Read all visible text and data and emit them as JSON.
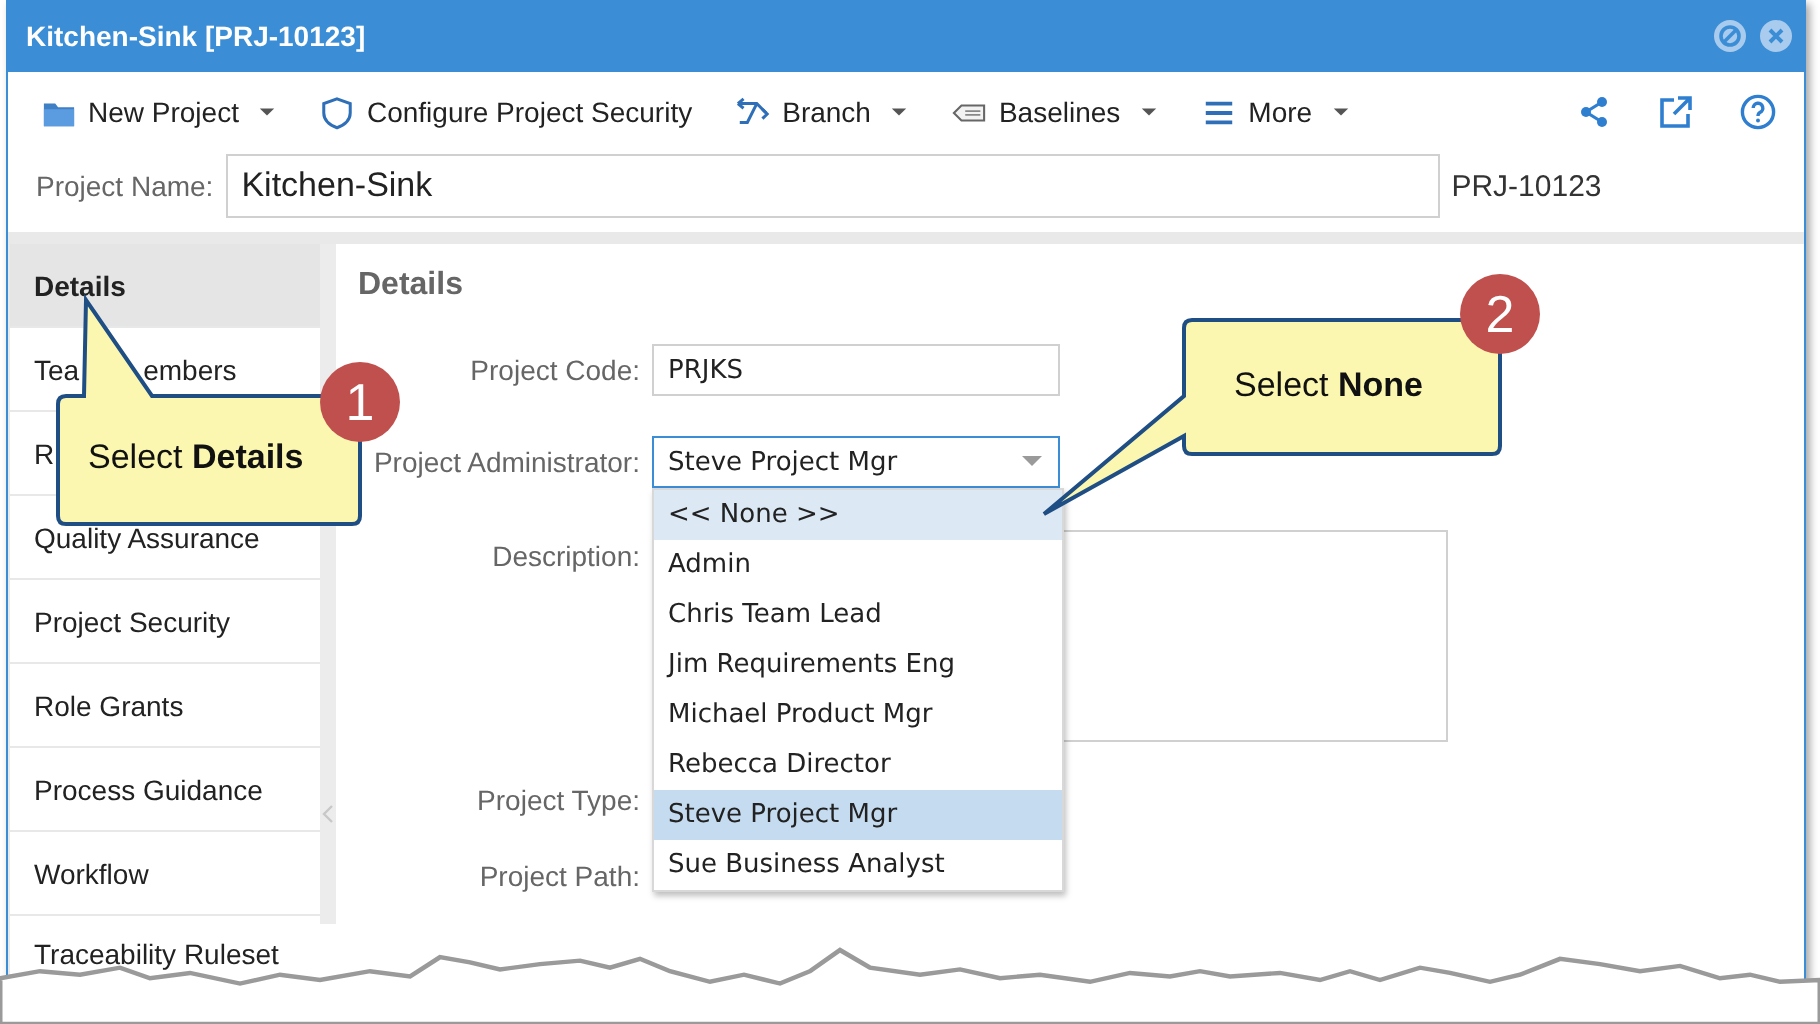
{
  "window": {
    "title": "Kitchen-Sink [PRJ-10123]"
  },
  "toolbar": {
    "items": [
      {
        "label": "New Project",
        "kind": "folder",
        "dropdown": true
      },
      {
        "label": "Configure Project Security",
        "kind": "shield",
        "dropdown": false
      },
      {
        "label": "Branch",
        "kind": "branch",
        "dropdown": true
      },
      {
        "label": "Baselines",
        "kind": "tag",
        "dropdown": true
      },
      {
        "label": "More",
        "kind": "menu",
        "dropdown": true
      }
    ]
  },
  "project_name": {
    "label": "Project Name:",
    "value": "Kitchen-Sink",
    "code": "PRJ-10123"
  },
  "sidebar": {
    "items": [
      {
        "label": "Details",
        "selected": true
      },
      {
        "label_parts": [
          "Tea",
          "embers"
        ],
        "selected": false
      },
      {
        "label": "R",
        "selected": false
      },
      {
        "label": "Quality Assurance",
        "selected": false
      },
      {
        "label": "Project Security",
        "selected": false
      },
      {
        "label": "Role Grants",
        "selected": false
      },
      {
        "label": "Process Guidance",
        "selected": false
      },
      {
        "label": "Workflow",
        "selected": false
      },
      {
        "label": "Traceability Ruleset",
        "selected": false
      }
    ]
  },
  "details": {
    "title": "Details",
    "fields": [
      {
        "kind": "text",
        "label": "Project Code:",
        "value": "PRJKS"
      },
      {
        "kind": "select",
        "label": "Project Administrator:",
        "value": "Steve Project Mgr",
        "expanded": true,
        "options": [
          {
            "label": "<< None >>",
            "hovered": true,
            "selected": false
          },
          {
            "label": "Admin",
            "hovered": false,
            "selected": false
          },
          {
            "label": "Chris Team Lead",
            "hovered": false,
            "selected": false
          },
          {
            "label": "Jim Requirements Eng",
            "hovered": false,
            "selected": false
          },
          {
            "label": "Michael Product Mgr",
            "hovered": false,
            "selected": false
          },
          {
            "label": "Rebecca Director",
            "hovered": false,
            "selected": false
          },
          {
            "label": "Steve Project Mgr",
            "hovered": false,
            "selected": true
          },
          {
            "label": "Sue Business Analyst",
            "hovered": false,
            "selected": false
          }
        ]
      },
      {
        "kind": "textarea",
        "label": "Description:"
      },
      {
        "kind": "hidden",
        "label": "Project Type:"
      },
      {
        "kind": "hidden",
        "label": "Project Path:"
      }
    ]
  },
  "callouts": [
    {
      "number": "1",
      "text": "Select **Details**"
    },
    {
      "number": "2",
      "text": "Select **None**"
    }
  ]
}
